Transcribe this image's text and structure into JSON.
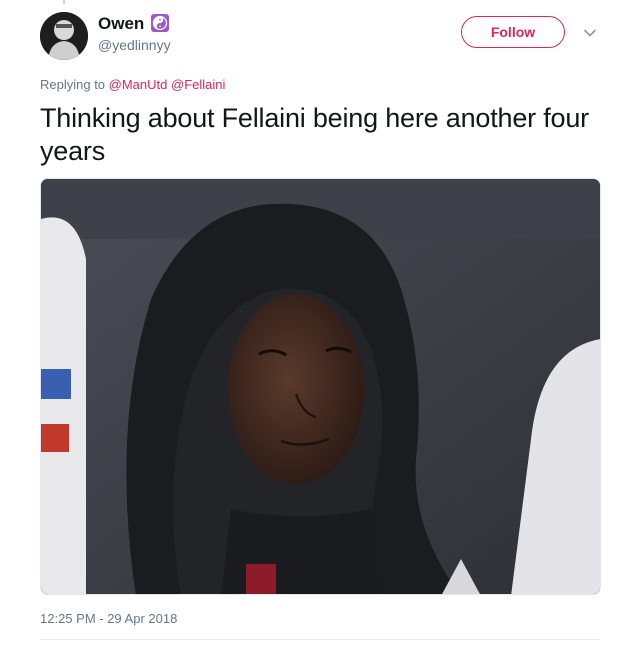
{
  "tweet": {
    "author": {
      "display_name": "Owen",
      "handle": "@yedlinnyy",
      "badge_icon": "yin-yang-icon"
    },
    "follow_label": "Follow",
    "replying": {
      "prefix": "Replying to ",
      "mentions": [
        "@ManUtd",
        "@Fellaini"
      ]
    },
    "text": "Thinking about Fellaini being here another four years",
    "timestamp": "12:25 PM - 29 Apr 2018"
  },
  "colors": {
    "accent": "#e0245e",
    "secondary_text": "#657786",
    "badge": "#9b59d0"
  }
}
